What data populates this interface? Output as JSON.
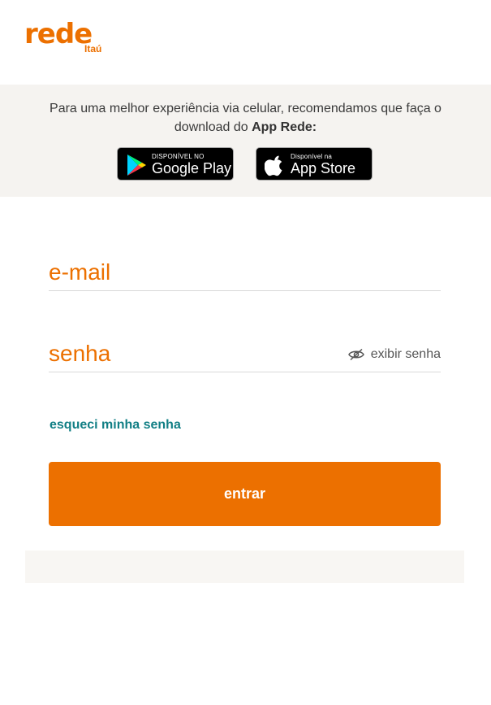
{
  "brand": {
    "logo_word": "rede",
    "logo_sub": "Itaú",
    "accent_color": "#ec7000",
    "link_color": "#127f85"
  },
  "app_banner": {
    "text": "Para uma melhor experiência via celular, recomendamos que faça o download do ",
    "app_name": "App Rede:",
    "google_play": {
      "small": "DISPONÍVEL NO",
      "big": "Google Play",
      "icon": "google-play-icon"
    },
    "app_store": {
      "small": "Disponível na",
      "big": "App Store",
      "icon": "apple-icon"
    }
  },
  "login": {
    "email_placeholder": "e-mail",
    "password_placeholder": "senha",
    "show_password_label": "exibir senha",
    "show_password_icon": "eye-slash-icon",
    "forgot_password": "esqueci minha senha",
    "submit_label": "entrar"
  }
}
